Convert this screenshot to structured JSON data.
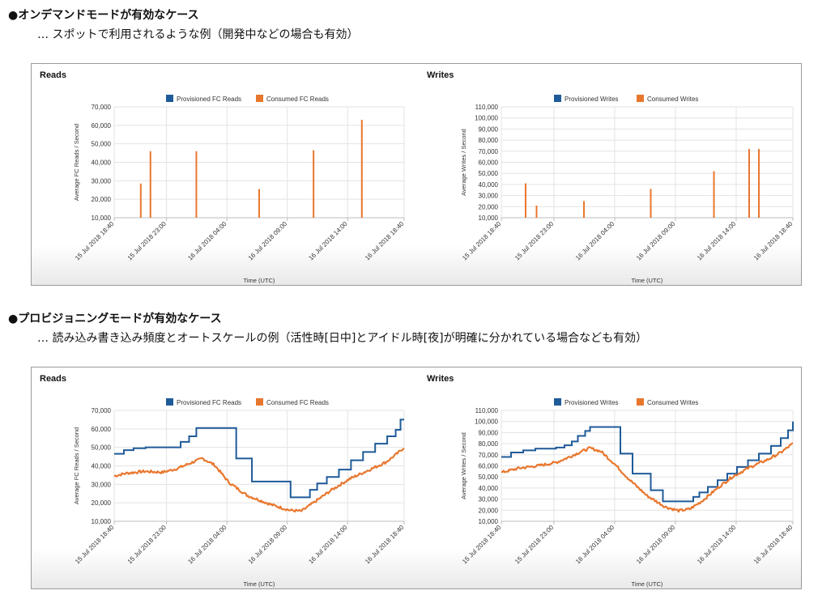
{
  "sections": [
    {
      "heading": "●オンデマンドモードが有効なケース",
      "subline": "… スポットで利用されるような例（開発中などの場合も有効）"
    },
    {
      "heading": "●プロビジョニングモードが有効なケース",
      "subline": "… 読み込み書き込み頻度とオートスケールの例（活性時[日中]とアイドル時[夜]が明確に分かれている場合なども有効）"
    }
  ],
  "colors": {
    "provisioned": "#1f5b99",
    "consumed": "#e8772e"
  },
  "chart_data": [
    {
      "id": "od-reads",
      "type": "bar",
      "title": "Reads",
      "ylabel": "Average FC Reads / Second",
      "xlabel": "Time (UTC)",
      "legend": [
        "Provisioned FC Reads",
        "Consumed FC Reads"
      ],
      "ylim": [
        10000,
        70000
      ],
      "yticks": [
        10000,
        20000,
        30000,
        40000,
        50000,
        60000,
        70000
      ],
      "ytick_labels": [
        "10,000",
        "20,000",
        "30,000",
        "40,000",
        "50,000",
        "60,000",
        "70,000"
      ],
      "xticks": [
        "15 Jul 2018 18:40",
        "15 Jul 2018 23:00",
        "16 Jul 2018 04:00",
        "16 Jul 2018 09:00",
        "16 Jul 2018 14:00",
        "16 Jul 2018 18:40"
      ],
      "x_hours": [
        0,
        4.33,
        9.33,
        14.33,
        19.33,
        24
      ],
      "series": [
        {
          "name": "Consumed FC Reads",
          "points": [
            [
              2.2,
              28500
            ],
            [
              3.0,
              46000
            ],
            [
              6.8,
              46000
            ],
            [
              12.0,
              25500
            ],
            [
              16.5,
              46500
            ],
            [
              20.5,
              63000
            ]
          ]
        }
      ]
    },
    {
      "id": "od-writes",
      "type": "bar",
      "title": "Writes",
      "ylabel": "Average Writes / Second",
      "xlabel": "Time (UTC)",
      "legend": [
        "Provisioned Writes",
        "Consumed Writes"
      ],
      "ylim": [
        10000,
        110000
      ],
      "yticks": [
        10000,
        20000,
        30000,
        40000,
        50000,
        60000,
        70000,
        80000,
        90000,
        100000,
        110000
      ],
      "ytick_labels": [
        "10,000",
        "20,000",
        "30,000",
        "40,000",
        "50,000",
        "60,000",
        "70,000",
        "80,000",
        "90,000",
        "100,000",
        "110,000"
      ],
      "xticks": [
        "15 Jul 2018 18:40",
        "15 Jul 2018 23:00",
        "16 Jul 2018 04:00",
        "16 Jul 2018 09:00",
        "16 Jul 2018 14:00",
        "16 Jul 2018 18:40"
      ],
      "x_hours": [
        0,
        4.33,
        9.33,
        14.33,
        19.33,
        24
      ],
      "series": [
        {
          "name": "Consumed Writes",
          "points": [
            [
              2.0,
              41000
            ],
            [
              2.9,
              21000
            ],
            [
              6.8,
              25000
            ],
            [
              12.3,
              36000
            ],
            [
              17.5,
              52000
            ],
            [
              20.4,
              72000
            ],
            [
              21.2,
              72000
            ]
          ]
        }
      ]
    },
    {
      "id": "pv-reads",
      "type": "line",
      "title": "Reads",
      "ylabel": "Average FC Reads / Second",
      "xlabel": "Time (UTC)",
      "legend": [
        "Provisioned FC Reads",
        "Consumed FC Reads"
      ],
      "ylim": [
        10000,
        70000
      ],
      "yticks": [
        10000,
        20000,
        30000,
        40000,
        50000,
        60000,
        70000
      ],
      "ytick_labels": [
        "10,000",
        "20,000",
        "30,000",
        "40,000",
        "50,000",
        "60,000",
        "70,000"
      ],
      "xticks": [
        "15 Jul 2018 18:40",
        "15 Jul 2018 23:00",
        "16 Jul 2018 04:00",
        "16 Jul 2018 09:00",
        "16 Jul 2018 14:00",
        "16 Jul 2018 18:40"
      ],
      "x_hours": [
        0,
        4.33,
        9.33,
        14.33,
        19.33,
        24
      ],
      "series": [
        {
          "name": "Provisioned FC Reads",
          "step": true,
          "points": [
            [
              0,
              46500
            ],
            [
              0.8,
              48500
            ],
            [
              1.6,
              49500
            ],
            [
              2.6,
              50000
            ],
            [
              5.5,
              53000
            ],
            [
              6.2,
              56000
            ],
            [
              6.8,
              60500
            ],
            [
              10.1,
              44000
            ],
            [
              11.4,
              31500
            ],
            [
              14.6,
              23000
            ],
            [
              16.2,
              27000
            ],
            [
              16.8,
              30500
            ],
            [
              17.6,
              34000
            ],
            [
              18.6,
              38000
            ],
            [
              19.6,
              43000
            ],
            [
              20.6,
              47500
            ],
            [
              21.6,
              52000
            ],
            [
              22.6,
              56000
            ],
            [
              23.3,
              59500
            ],
            [
              23.7,
              65000
            ],
            [
              24,
              65000
            ]
          ]
        },
        {
          "name": "Consumed FC Reads",
          "noise": true,
          "points": [
            [
              0,
              34500
            ],
            [
              1.0,
              36000
            ],
            [
              2.5,
              37000
            ],
            [
              4.0,
              36500
            ],
            [
              5.2,
              38500
            ],
            [
              6.5,
              42000
            ],
            [
              7.3,
              44000
            ],
            [
              8.3,
              40500
            ],
            [
              9.5,
              31000
            ],
            [
              11.0,
              24000
            ],
            [
              13.0,
              19000
            ],
            [
              14.5,
              16000
            ],
            [
              15.5,
              15500
            ],
            [
              16.5,
              20000
            ],
            [
              18.0,
              27000
            ],
            [
              19.5,
              33000
            ],
            [
              21.0,
              37500
            ],
            [
              22.5,
              42000
            ],
            [
              23.5,
              47000
            ],
            [
              24,
              50000
            ]
          ]
        }
      ]
    },
    {
      "id": "pv-writes",
      "type": "line",
      "title": "Writes",
      "ylabel": "Average Writes / Second",
      "xlabel": "Time (UTC)",
      "legend": [
        "Provisioned Writes",
        "Consumed Writes"
      ],
      "ylim": [
        10000,
        110000
      ],
      "yticks": [
        10000,
        20000,
        30000,
        40000,
        50000,
        60000,
        70000,
        80000,
        90000,
        100000,
        110000
      ],
      "ytick_labels": [
        "10,000",
        "20,000",
        "30,000",
        "40,000",
        "50,000",
        "60,000",
        "70,000",
        "80,000",
        "90,000",
        "100,000",
        "110,000"
      ],
      "xticks": [
        "15 Jul 2018 18:40",
        "15 Jul 2018 23:00",
        "16 Jul 2018 04:00",
        "16 Jul 2018 09:00",
        "16 Jul 2018 14:00",
        "16 Jul 2018 18:40"
      ],
      "x_hours": [
        0,
        4.33,
        9.33,
        14.33,
        19.33,
        24
      ],
      "series": [
        {
          "name": "Provisioned Writes",
          "step": true,
          "points": [
            [
              0,
              68000
            ],
            [
              0.8,
              72000
            ],
            [
              1.8,
              74000
            ],
            [
              2.8,
              75500
            ],
            [
              4.5,
              76500
            ],
            [
              5.2,
              78500
            ],
            [
              5.8,
              82000
            ],
            [
              6.3,
              87000
            ],
            [
              6.9,
              91500
            ],
            [
              7.3,
              95000
            ],
            [
              9.8,
              71000
            ],
            [
              10.8,
              53000
            ],
            [
              12.3,
              38000
            ],
            [
              13.3,
              28000
            ],
            [
              15.8,
              32000
            ],
            [
              16.3,
              36000
            ],
            [
              17.0,
              41000
            ],
            [
              17.8,
              47000
            ],
            [
              18.6,
              53000
            ],
            [
              19.4,
              59000
            ],
            [
              20.3,
              65000
            ],
            [
              21.2,
              71000
            ],
            [
              22.2,
              78000
            ],
            [
              23.0,
              85000
            ],
            [
              23.6,
              92000
            ],
            [
              24,
              100000
            ]
          ]
        },
        {
          "name": "Consumed Writes",
          "noise": true,
          "points": [
            [
              0,
              54000
            ],
            [
              1.5,
              58000
            ],
            [
              3.0,
              60000
            ],
            [
              4.5,
              63000
            ],
            [
              5.6,
              68000
            ],
            [
              6.6,
              73000
            ],
            [
              7.3,
              76000
            ],
            [
              8.2,
              73000
            ],
            [
              9.3,
              62000
            ],
            [
              10.5,
              48000
            ],
            [
              12.0,
              33000
            ],
            [
              13.5,
              23000
            ],
            [
              14.6,
              19500
            ],
            [
              15.5,
              21000
            ],
            [
              16.5,
              28000
            ],
            [
              17.8,
              40000
            ],
            [
              19.0,
              50000
            ],
            [
              20.5,
              59000
            ],
            [
              22.0,
              66000
            ],
            [
              23.0,
              72000
            ],
            [
              24,
              80000
            ]
          ]
        }
      ]
    }
  ]
}
